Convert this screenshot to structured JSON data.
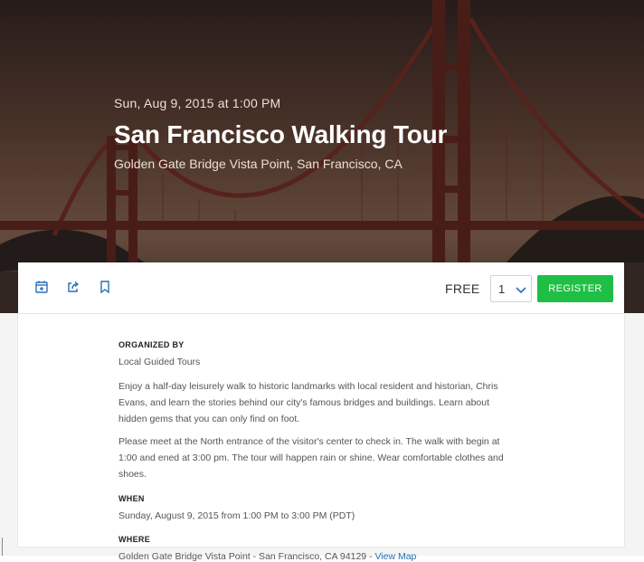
{
  "hero": {
    "date": "Sun, Aug 9, 2015 at 1:00 PM",
    "title": "San Francisco Walking Tour",
    "location": "Golden Gate Bridge Vista Point, San Francisco, CA"
  },
  "toolbar": {
    "icons": [
      "add-to-calendar-icon",
      "share-icon",
      "bookmark-icon"
    ],
    "price": "FREE",
    "quantity": "1",
    "register_label": "REGISTER",
    "register_color": "#1fbf46"
  },
  "details": {
    "organized_by_heading": "ORGANIZED BY",
    "organizer": "Local Guided Tours",
    "description_1": "Enjoy a half-day leisurely walk to historic landmarks with local resident and historian, Chris Evans, and learn the stories behind our city's famous bridges and buildings. Learn about hidden gems that you can only find on foot.",
    "description_2": "Please meet at the North entrance of the visitor's center to check in. The walk with begin at 1:00 and ened at 3:00 pm. The tour will happen rain or shine. Wear comfortable clothes and shoes.",
    "when_heading": "WHEN",
    "when_text": "Sunday, August 9, 2015 from 1:00 PM to 3:00 PM (PDT)",
    "where_heading": "WHERE",
    "where_text": "Golden Gate Bridge Vista Point - San Francisco, CA 94129 - ",
    "view_map": "View Map"
  },
  "colors": {
    "link": "#1e6fb6",
    "icon": "#2a6fb6"
  }
}
